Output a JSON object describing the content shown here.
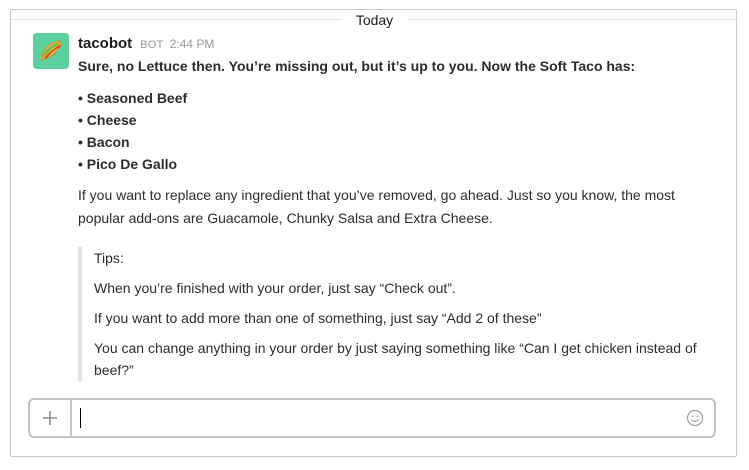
{
  "divider": {
    "label": "Today"
  },
  "message": {
    "sender": "tacobot",
    "badge": "BOT",
    "time": "2:44 PM",
    "lead": "Sure, no Lettuce then. You’re missing out, but it’s up to you. Now the Soft Taco has:",
    "bullets": [
      "• Seasoned Beef",
      "• Cheese",
      "• Bacon",
      "• Pico De Gallo"
    ],
    "paragraph": "If you want to replace any ingredient that you’ve removed, go ahead. Just so you know, the most popular add-ons are Guacamole, Chunky Salsa and Extra Cheese.",
    "tips": {
      "title": "Tips:",
      "lines": [
        "When you’re finished with your order, just say “Check out”.",
        "If you want to add more than one of something, just say “Add 2 of these”",
        "You can change anything in your order by just saying something like “Can I get chicken instead of beef?”"
      ]
    }
  },
  "composer": {
    "value": "",
    "plus_icon": "plus-icon",
    "emoji_icon": "smiley-icon"
  },
  "colors": {
    "avatar_bg": "#5ed0a0",
    "border": "#c4c4c4",
    "quote_bar": "#e1e1e1"
  }
}
